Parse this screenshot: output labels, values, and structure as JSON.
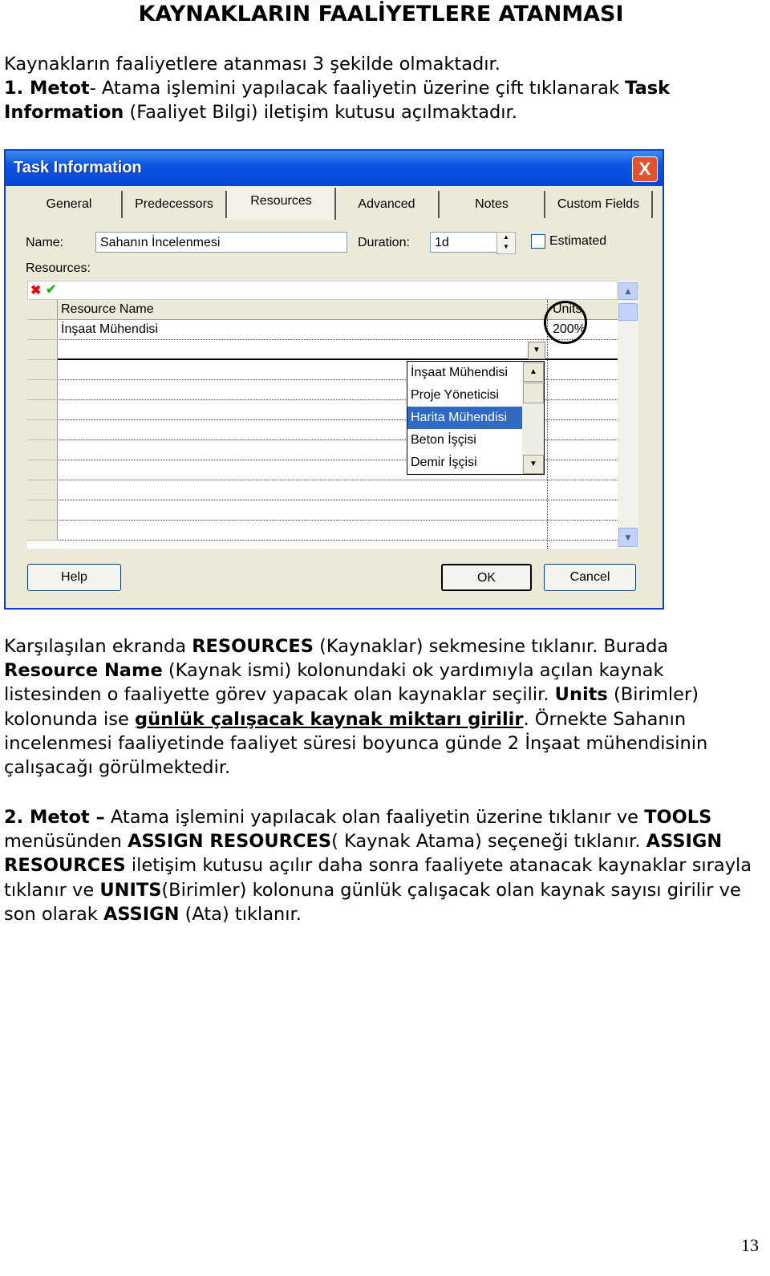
{
  "title": "KAYNAKLARIN FAALİYETLERE ATANMASI",
  "intro": {
    "line1": "Kaynakların faaliyetlere atanması 3 şekilde olmaktadır.",
    "m1_label": "1. Metot",
    "m1_text1": "- Atama işlemini yapılacak faaliyetin üzerine çift tıklanarak ",
    "m1_bold": "Task Information",
    "m1_text2": " (Faaliyet Bilgi) iletişim kutusu açılmaktadır."
  },
  "dialog": {
    "title": "Task Information",
    "close": "X",
    "tabs": [
      "General",
      "Predecessors",
      "Resources",
      "Advanced",
      "Notes",
      "Custom Fields"
    ],
    "selected_tab": "Resources",
    "name_label": "Name:",
    "name_value": "Sahanın İncelenmesi",
    "duration_label": "Duration:",
    "duration_value": "1d",
    "estimated_label": "Estimated",
    "estimated_checked": false,
    "resources_label": "Resources:",
    "grid": {
      "col_name": "Resource Name",
      "col_units": "Units",
      "rows": [
        {
          "name": "İnşaat Mühendisi",
          "units": "200%"
        }
      ]
    },
    "dropdown": {
      "items": [
        "İnşaat Mühendisi",
        "Proje Yöneticisi",
        "Harita Mühendisi",
        "Beton İşçisi",
        "Demir İşçisi"
      ],
      "highlighted": "Harita Mühendisi"
    },
    "buttons": {
      "help": "Help",
      "ok": "OK",
      "cancel": "Cancel"
    },
    "colors": {
      "titlebar": "#0B54E0",
      "highlight": "#316AC5",
      "face": "#ECE9D8"
    }
  },
  "p2": {
    "t1": "Karşılaşılan ekranda ",
    "b1": "RESOURCES",
    "t2": " (Kaynaklar) sekmesine tıklanır. Burada ",
    "b2": "Resource Name",
    "t3": " (Kaynak ismi) kolonundaki ok yardımıyla açılan kaynak listesinden o faaliyette görev yapacak olan kaynaklar seçilir. ",
    "b3": "Units",
    "t4": " (Birimler) kolonunda ise ",
    "u1": "günlük çalışacak kaynak miktarı girilir",
    "t5": ". Örnekte Sahanın incelenmesi faaliyetinde faaliyet süresi boyunca günde 2 İnşaat mühendisinin çalışacağı görülmektedir."
  },
  "p3": {
    "b1": "2. Metot –",
    "t1": " Atama işlemini yapılacak olan faaliyetin üzerine tıklanır ve ",
    "b2": "TOOLS",
    "t2": " menüsünden ",
    "b3": "ASSIGN RESOURCES",
    "t3": "( Kaynak Atama) seçeneği tıklanır. ",
    "b4": "ASSIGN RESOURCES",
    "t4": " iletişim kutusu açılır daha sonra faaliyete atanacak kaynaklar sırayla tıklanır ve ",
    "b5": "UNITS",
    "t5": "(Birimler) kolonuna günlük çalışacak olan kaynak sayısı girilir ve son olarak ",
    "b6": "ASSIGN",
    "t6": " (Ata) tıklanır."
  },
  "page_number": "13"
}
